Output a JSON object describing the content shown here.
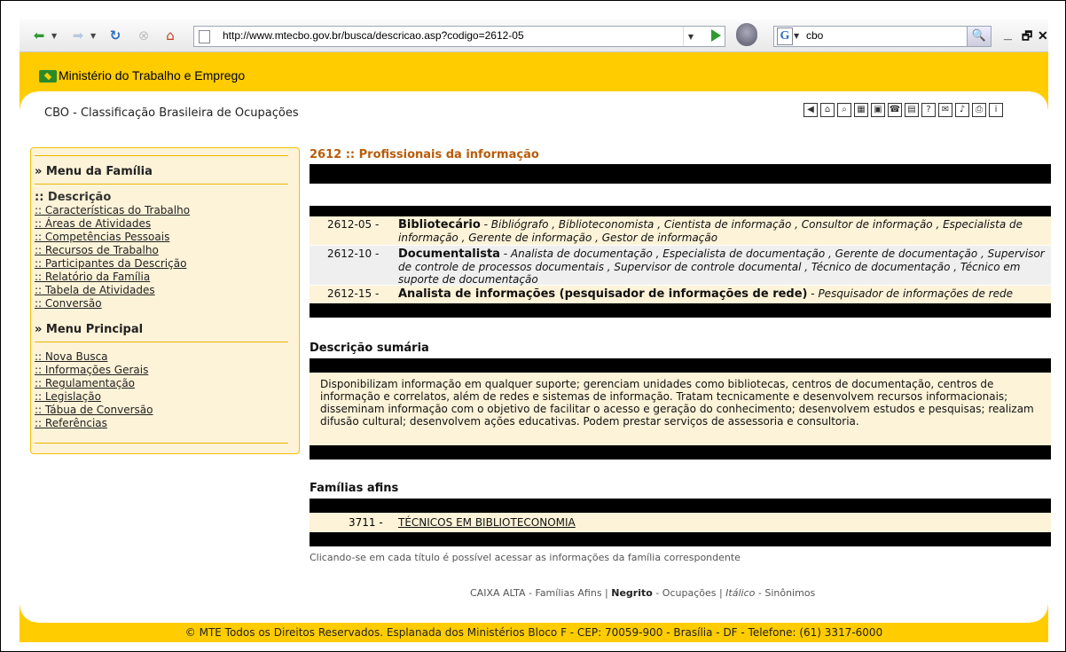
{
  "browser": {
    "url": "http://www.mtecbo.gov.br/busca/descricao.asp?codigo=2612-05",
    "search_value": "cbo",
    "search_engine_letter": "G",
    "minimize": "_",
    "restore": "🗗",
    "close": "✕"
  },
  "header": {
    "ministry": "Ministério do Trabalho e Emprego",
    "cbo_title": "CBO - Classificação Brasileira de Ocupações",
    "brand_color": "#ffcc00"
  },
  "sidebar": {
    "family_menu_title": "» Menu da Família",
    "family_items": [
      ":: Descrição",
      ":: Características do Trabalho",
      ":: Áreas de Atividades",
      ":: Competências Pessoais",
      ":: Recursos de Trabalho",
      ":: Participantes da Descrição",
      ":: Relatório da Família",
      ":: Tabela de Atividades",
      ":: Conversão"
    ],
    "main_menu_title": "» Menu Principal",
    "main_items": [
      ":: Nova Busca",
      ":: Informações Gerais",
      ":: Regulamentação",
      ":: Legislação",
      ":: Tábua de Conversão",
      ":: Referências"
    ]
  },
  "main": {
    "family_title": "2612 :: Profissionais da informação",
    "occupations": [
      {
        "code": "2612-05 -",
        "name": "Bibliotecário",
        "synonyms": " - Bibliógrafo , Biblioteconomista , Cientista de informação , Consultor de informação , Especialista de informação , Gerente de informação , Gestor de informação"
      },
      {
        "code": "2612-10 -",
        "name": "Documentalista",
        "synonyms": " - Analista de documentação , Especialista de documentação , Gerente de documentação , Supervisor de controle de processos documentais , Supervisor de controle documental , Técnico de documentação , Técnico em suporte de documentação"
      },
      {
        "code": "2612-15 -",
        "name": "Analista de informações (pesquisador de informações de rede)",
        "synonyms": " - Pesquisador de informações de rede"
      }
    ],
    "summary_title": "Descrição sumária",
    "summary_text": "Disponibilizam informação em qualquer suporte; gerenciam unidades como bibliotecas, centros de documentação, centros de informação e correlatos, além de redes e sistemas de informação. Tratam tecnicamente e desenvolvem recursos informacionais; disseminam informação com o objetivo de facilitar o acesso e geração do conhecimento; desenvolvem estudos e pesquisas; realizam difusão cultural; desenvolvem ações educativas. Podem prestar serviços de assessoria e consultoria.",
    "related_title": "Famílias afins",
    "related_code": "3711 -",
    "related_name": "TÉCNICOS EM BIBLIOTECONOMIA",
    "note": "Clicando-se em cada título é possível acessar as informações da família correspondente",
    "legend_upper": "CAIXA ALTA - Famílias Afins  |  ",
    "legend_bold": "Negrito",
    "legend_mid": " - Ocupações  |  ",
    "legend_italic": "Itálico",
    "legend_end": " - Sinônimos"
  },
  "footer": {
    "text": "© MTE Todos os Direitos Reservados. Esplanada dos Ministérios Bloco F - CEP: 70059-900 - Brasília - DF - Telefone: (61) 3317-6000"
  }
}
